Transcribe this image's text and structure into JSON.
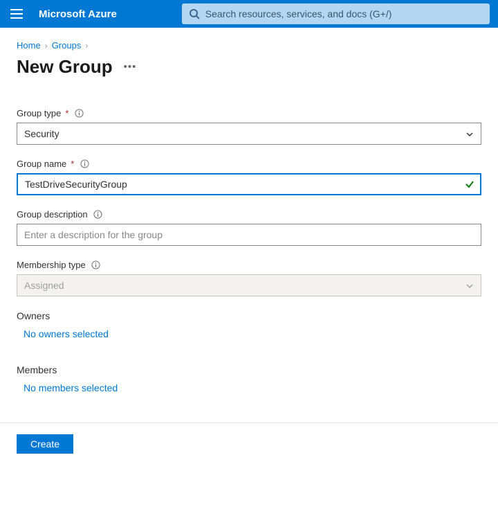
{
  "topbar": {
    "brand": "Microsoft Azure",
    "search_placeholder": "Search resources, services, and docs (G+/)"
  },
  "breadcrumb": {
    "home": "Home",
    "groups": "Groups"
  },
  "page": {
    "title": "New Group"
  },
  "form": {
    "group_type": {
      "label": "Group type",
      "value": "Security"
    },
    "group_name": {
      "label": "Group name",
      "value": "TestDriveSecurityGroup"
    },
    "group_description": {
      "label": "Group description",
      "placeholder": "Enter a description for the group",
      "value": ""
    },
    "membership_type": {
      "label": "Membership type",
      "value": "Assigned"
    },
    "owners": {
      "heading": "Owners",
      "link": "No owners selected"
    },
    "members": {
      "heading": "Members",
      "link": "No members selected"
    }
  },
  "footer": {
    "create_label": "Create"
  }
}
